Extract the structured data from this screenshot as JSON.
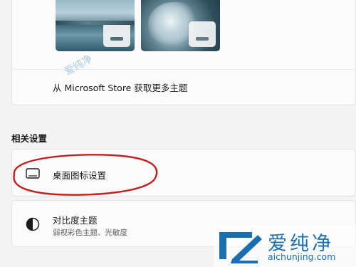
{
  "themes": {
    "items": [
      {
        "name": "lake-theme"
      },
      {
        "name": "bloom-theme"
      }
    ],
    "store_link": "从 Microsoft Store 获取更多主题"
  },
  "related_settings": {
    "title": "相关设置",
    "items": [
      {
        "icon": "monitor-icon",
        "title": "桌面图标设置",
        "subtitle": ""
      },
      {
        "icon": "contrast-icon",
        "title": "对比度主题",
        "subtitle": "弱视彩色主题、光敏度"
      }
    ]
  },
  "annotation": {
    "color": "#c4201f"
  },
  "watermark": {
    "diagonal_text": "爱纯净",
    "brand": "爱纯净",
    "url": "aichunjing.com",
    "color": "#1a6fb0"
  }
}
